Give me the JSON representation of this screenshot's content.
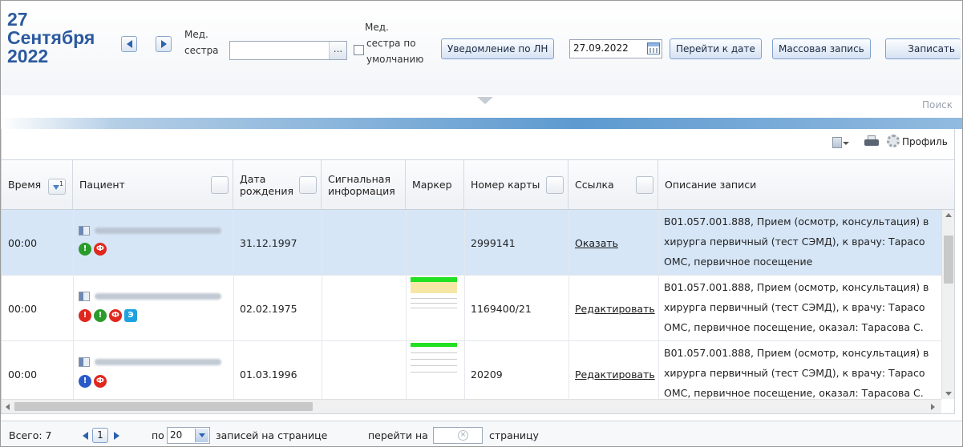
{
  "header": {
    "date_day": "27",
    "date_month": "Сентября",
    "date_year": "2022",
    "nurse_label_line1": "Мед.",
    "nurse_label_line2": "сестра",
    "nurse_value": "",
    "dots_label": "...",
    "default_nurse_label_line1": "Мед.",
    "default_nurse_label_line2": "сестра по",
    "default_nurse_label_line3": "умолчанию",
    "sick_leave_button": "Уведомление по ЛН",
    "date_value": "27.09.2022",
    "goto_date_button": "Перейти к дате",
    "mass_record_button": "Массовая запись",
    "record_button": "Записать",
    "search_label": "Поиск"
  },
  "grid_toolbar": {
    "profile_label": "Профиль"
  },
  "table": {
    "columns": {
      "time": "Время",
      "sort_index": "1",
      "patient": "Пациент",
      "dob_line1": "Дата",
      "dob_line2": "рождения",
      "signal_line1": "Сигнальная",
      "signal_line2": "информация",
      "marker": "Маркер",
      "card": "Номер карты",
      "link": "Ссылка",
      "description": "Описание записи"
    },
    "rows": [
      {
        "time": "00:00",
        "dob": "31.12.1997",
        "card": "2999141",
        "link": "Оказать",
        "desc1": "B01.057.001.888, Прием (осмотр, консультация) в",
        "desc2": "хирурга первичный (тест СЭМД), к врачу: Тарасо",
        "desc3": "ОМС, первичное посещение",
        "badges": [
          "!",
          "Ф"
        ]
      },
      {
        "time": "00:00",
        "dob": "02.02.1975",
        "card": "1169400/21",
        "link": "Редактировать",
        "desc1": "B01.057.001.888, Прием (осмотр, консультация) в",
        "desc2": "хирурга первичный (тест СЭМД), к врачу: Тарасо",
        "desc3": "ОМС, первичное посещение, оказал: Тарасова С.",
        "badges": [
          "!",
          "!",
          "Ф",
          "Э"
        ]
      },
      {
        "time": "00:00",
        "dob": "01.03.1996",
        "card": "20209",
        "link": "Редактировать",
        "desc1": "B01.057.001.888, Прием (осмотр, консультация) в",
        "desc2": "хирурга первичный (тест СЭМД), к врачу: Тарасо",
        "desc3": "ОМС, первичное посещение, оказал: Тарасова С.",
        "badges": [
          "!",
          "Ф"
        ]
      }
    ]
  },
  "pager": {
    "total": "Всего: 7",
    "page": "1",
    "per_label": "по",
    "per_value": "20",
    "per_suffix": "записей на странице",
    "goto_label": "перейти на",
    "goto_suffix": "страницу",
    "clear_icon": "×"
  },
  "colors": {
    "accent": "#2b5a9e",
    "selected_row": "#d6e6f7",
    "marker_green": "#22e022",
    "marker_yellow": "#f6e7a6"
  }
}
